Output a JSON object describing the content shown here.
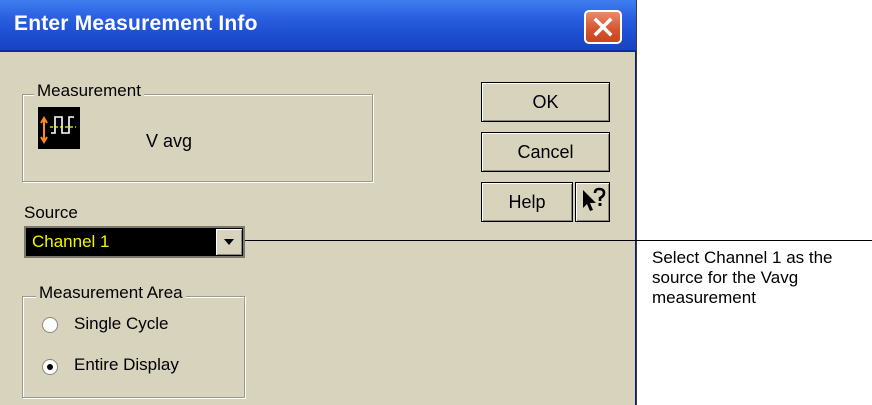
{
  "dialog": {
    "title": "Enter Measurement Info",
    "close_icon": "close-icon",
    "colors": {
      "titlebar": "#2a5fe0",
      "body": "#d8d3bd",
      "source_combo_bg": "#000000",
      "source_combo_text": "#f5f200"
    }
  },
  "measurement": {
    "legend": "Measurement",
    "name": "V avg",
    "icon": "vavg-waveform-icon"
  },
  "buttons": {
    "ok": "OK",
    "cancel": "Cancel",
    "help": "Help",
    "whats_this_icon": "whats-this-icon"
  },
  "source": {
    "label": "Source",
    "selected": "Channel 1"
  },
  "measurement_area": {
    "legend": "Measurement Area",
    "options": [
      {
        "label": "Single Cycle",
        "selected": false
      },
      {
        "label": "Entire Display",
        "selected": true
      }
    ]
  },
  "annotation": {
    "lines": [
      "Select Channel 1 as the",
      "source for the Vavg",
      "measurement"
    ]
  }
}
